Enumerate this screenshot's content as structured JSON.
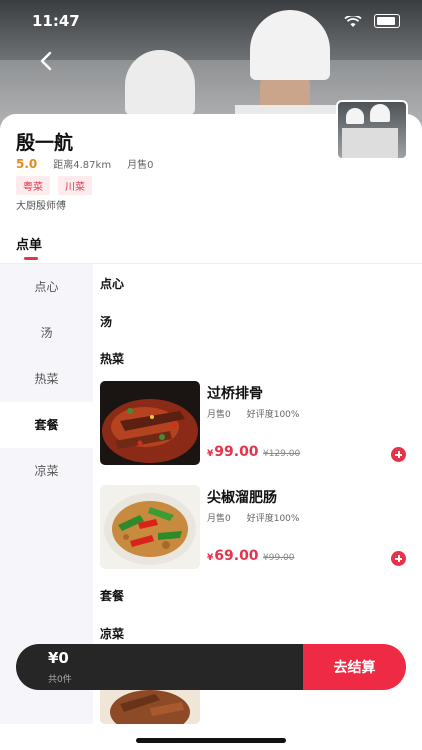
{
  "status_bar": {
    "time": "11:47"
  },
  "shop": {
    "name": "殷一航",
    "rating": "5.0",
    "distance": "距离4.87km",
    "monthly_sales": "月售0",
    "tags": [
      "粤菜",
      "川菜"
    ],
    "chef_title": "大厨殷师傅"
  },
  "tabs": {
    "order": "点单"
  },
  "sidebar": {
    "items": [
      {
        "label": "点心"
      },
      {
        "label": "汤"
      },
      {
        "label": "热菜"
      },
      {
        "label": "套餐",
        "active": true
      },
      {
        "label": "凉菜"
      }
    ]
  },
  "menu": {
    "sections": [
      "点心",
      "汤",
      "热菜",
      "套餐",
      "凉菜"
    ],
    "dishes": [
      {
        "name": "过桥排骨",
        "sales": "月售0",
        "rating": "好评度100%",
        "currency": "¥",
        "price": "99.00",
        "original_price": "¥129.00"
      },
      {
        "name": "尖椒溜肥肠",
        "sales": "月售0",
        "rating": "好评度100%",
        "currency": "¥",
        "price": "69.00",
        "original_price": "¥99.00"
      }
    ]
  },
  "cart": {
    "amount": "¥0",
    "count": "共0件",
    "checkout_label": "去结算"
  },
  "colors": {
    "accent": "#ef2a45",
    "rating": "#e8891d",
    "cart_bg": "#262626"
  }
}
